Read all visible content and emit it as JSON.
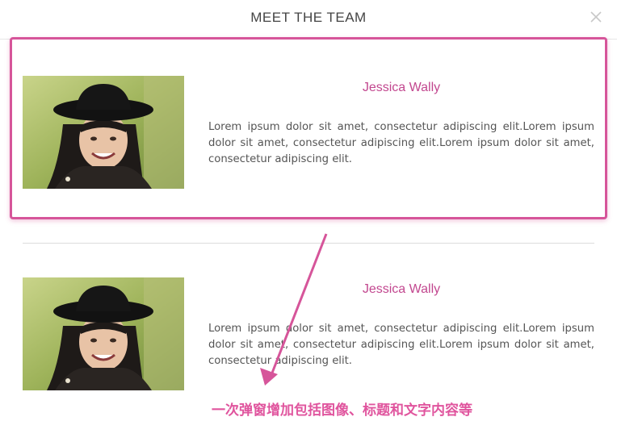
{
  "modal": {
    "title": "MEET THE TEAM",
    "close_icon": "close-icon"
  },
  "members": [
    {
      "name": "Jessica Wally",
      "bio": "Lorem ipsum dolor sit amet, consectetur adipiscing elit.Lorem ipsum dolor sit amet, consectetur adipiscing elit.Lorem ipsum dolor sit amet, consectetur adipiscing elit.",
      "photo_icon": "portrait-photo"
    },
    {
      "name": "Jessica Wally",
      "bio": "Lorem ipsum dolor sit amet, consectetur adipiscing elit.Lorem ipsum dolor sit amet, consectetur adipiscing elit.Lorem ipsum dolor sit amet, consectetur adipiscing elit.",
      "photo_icon": "portrait-photo"
    }
  ],
  "annotation": {
    "text": "一次弹窗增加包括图像、标题和文字内容等",
    "color": "#e0559e"
  },
  "colors": {
    "accent": "#c2478f",
    "highlight": "#d6559a"
  }
}
